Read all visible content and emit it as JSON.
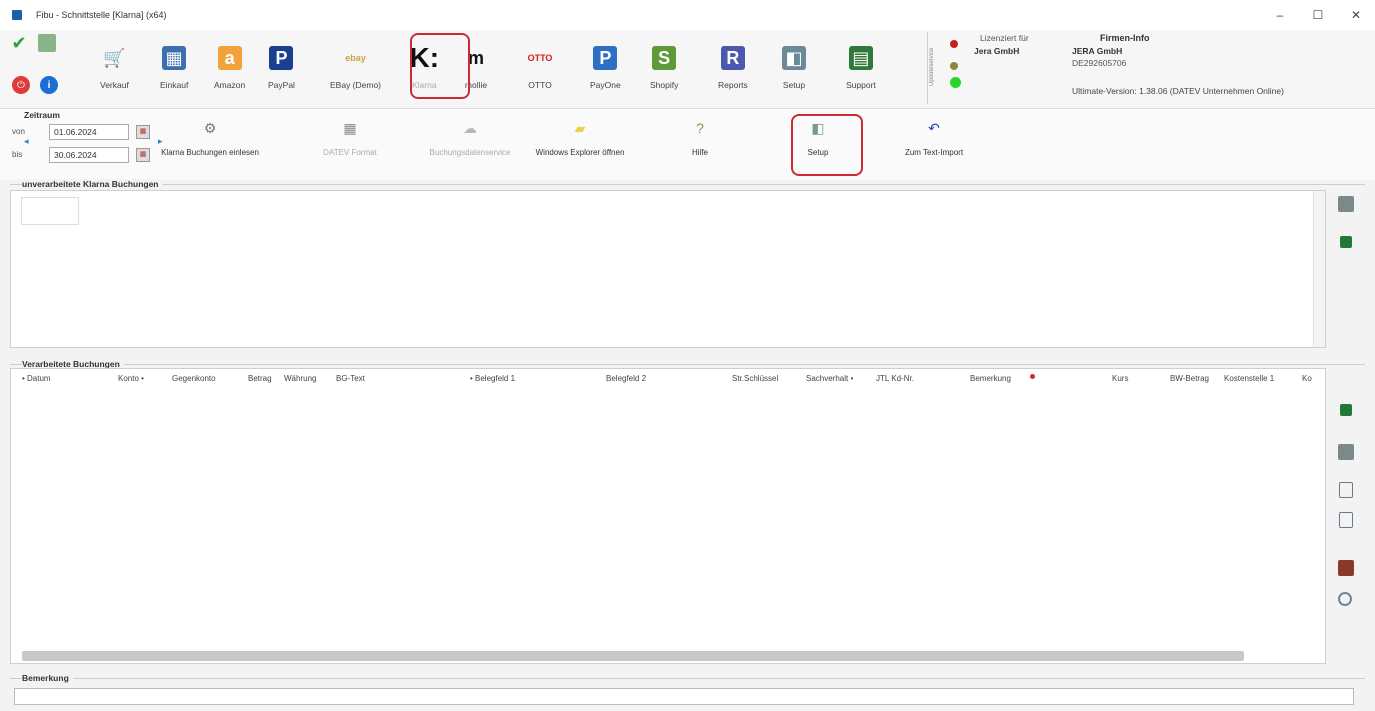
{
  "window": {
    "title": "Fibu - Schnittstelle [Klarna] (x64)",
    "minimize": "–",
    "maximize": "☐",
    "close": "✕"
  },
  "toolbar": {
    "items": [
      {
        "label": "Verkauf",
        "glyph": "🛒",
        "color": "#4d7a3a"
      },
      {
        "label": "Einkauf",
        "glyph": "▦",
        "color": "#3d6fb0"
      },
      {
        "label": "Amazon",
        "glyph": "a",
        "color": "#f2a23a"
      },
      {
        "label": "PayPal",
        "glyph": "P",
        "color": "#1b3f8f"
      },
      {
        "label": "EBay (Demo)",
        "glyph": "ebay",
        "color": "#c8a53a"
      },
      {
        "label": "Klarna",
        "glyph": "K:",
        "color": "#111111"
      },
      {
        "label": "mollie",
        "glyph": "m",
        "color": "#111111"
      },
      {
        "label": "OTTO",
        "glyph": "OTTO",
        "color": "#d6201e"
      },
      {
        "label": "PayOne",
        "glyph": "P",
        "color": "#2d6fc4"
      },
      {
        "label": "Shopify",
        "glyph": "S",
        "color": "#5c9a3a"
      },
      {
        "label": "Reports",
        "glyph": "R",
        "color": "#4a58b0"
      },
      {
        "label": "Setup",
        "glyph": "◧",
        "color": "#6a8a9a"
      },
      {
        "label": "Support",
        "glyph": "▤",
        "color": "#2f7a3a"
      }
    ]
  },
  "status": {
    "updateservice": "Updateservice",
    "lights": [
      "#c2221c",
      "#8a8a3a",
      "#2bd42b"
    ]
  },
  "license": {
    "label": "Lizenziert für",
    "name": "Jera GmbH"
  },
  "company": {
    "label": "Firmen-Info",
    "name": "JERA GmbH",
    "vat": "DE292605706",
    "version": "Ultimate-Version: 1.38.06 (DATEV Unternehmen Online)"
  },
  "zeitraum": {
    "title": "Zeitraum",
    "von_label": "von",
    "bis_label": "bis",
    "von": "01.06.2024",
    "bis": "30.06.2024"
  },
  "actions": [
    {
      "label": "Klarna Buchungen einlesen",
      "glyph": "⚙",
      "color": "#6b7a8a",
      "disabled": false
    },
    {
      "label": "DATEV Format",
      "glyph": "▦",
      "color": "#8a8a8a",
      "disabled": true
    },
    {
      "label": "Buchungsdatenservice",
      "glyph": "☁",
      "color": "#b8b8b8",
      "disabled": true
    },
    {
      "label": "Windows Explorer öffnen",
      "glyph": "▰",
      "color": "#e8d44a",
      "disabled": false
    },
    {
      "label": "Hilfe",
      "glyph": "?",
      "color": "#7a9a5a",
      "disabled": false
    },
    {
      "label": "Setup",
      "glyph": "◧",
      "color": "#7a9a8a",
      "disabled": false
    },
    {
      "label": "Zum Text-Import",
      "glyph": "↶",
      "color": "#1b4fa9",
      "disabled": false
    }
  ],
  "sections": {
    "unprocessed": "unverarbeitete Klarna Buchungen",
    "processed": "Verarbeitete Buchungen",
    "remark": "Bemerkung"
  },
  "columns": [
    "• Datum",
    "Konto •",
    "Gegenkonto",
    "Betrag",
    "Währung",
    "BG-Text",
    "• Belegfeld 1",
    "Belegfeld 2",
    "Str.Schlüssel",
    "Sachverhalt •",
    "JTL Kd-Nr.",
    "Bemerkung",
    "Kurs",
    "BW-Betrag",
    "Kostenstelle 1",
    "Ko"
  ]
}
